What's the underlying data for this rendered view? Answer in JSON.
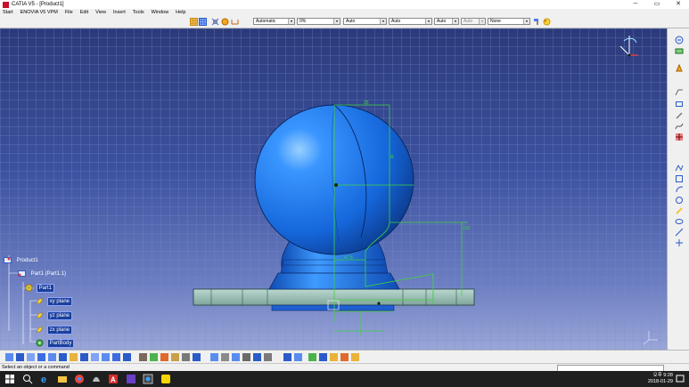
{
  "window": {
    "title": "CATIA V5 - [Product1]",
    "minimize": "─",
    "maximize": "▭",
    "close": "✕"
  },
  "menu": [
    "Start",
    "ENOVIA V5 VPM",
    "File",
    "Edit",
    "View",
    "Insert",
    "Tools",
    "Window",
    "Help"
  ],
  "toolbar": {
    "combos": [
      {
        "value": "Automatic",
        "disabled": false
      },
      {
        "value": "0%",
        "disabled": false
      },
      {
        "value": "Auto",
        "disabled": false
      },
      {
        "value": "Auto",
        "disabled": false
      },
      {
        "value": "Auto",
        "disabled": false
      },
      {
        "value": "Auto",
        "disabled": true
      },
      {
        "value": "None",
        "disabled": false
      }
    ]
  },
  "tree": {
    "root": "Product1",
    "part": "Part1 (Part1.1)",
    "body": "Part1",
    "planes": [
      "xy plane",
      "yz plane",
      "zx plane"
    ],
    "partbody": "PartBody"
  },
  "dimensions": {
    "top": "25",
    "vertical": "150",
    "mid": "47.5",
    "r": "R"
  },
  "status": {
    "message": "Select an object or a command"
  },
  "taskbar": {
    "time": "오후 9:28",
    "date": "2018-01-29"
  },
  "colors": {
    "accent": "#1e6fe0",
    "sketch": "#3fd43f"
  }
}
